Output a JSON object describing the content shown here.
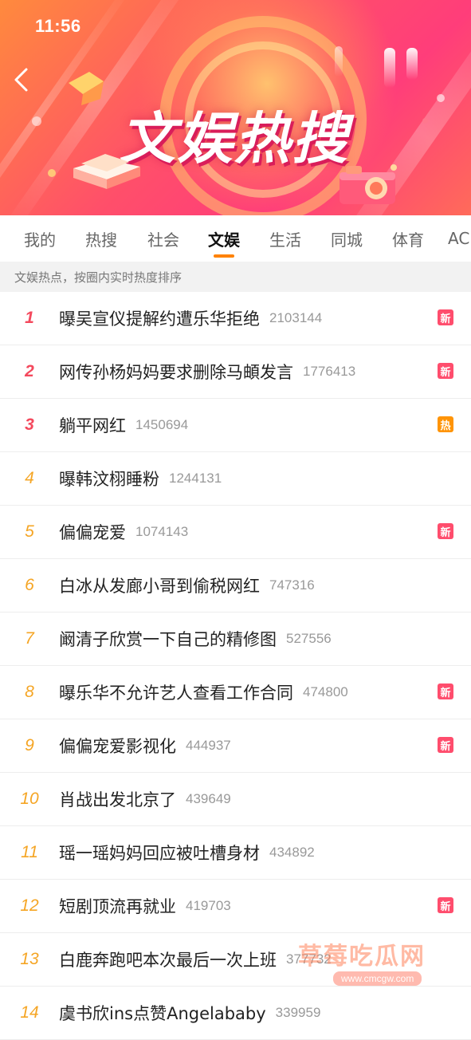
{
  "status_bar": {
    "time": "11:56"
  },
  "banner": {
    "title": "文娱热搜"
  },
  "tabs": [
    {
      "label": "我的",
      "active": false
    },
    {
      "label": "热搜",
      "active": false
    },
    {
      "label": "社会",
      "active": false
    },
    {
      "label": "文娱",
      "active": true
    },
    {
      "label": "生活",
      "active": false
    },
    {
      "label": "同城",
      "active": false
    },
    {
      "label": "体育",
      "active": false
    },
    {
      "label": "AC",
      "active": false
    }
  ],
  "hint": "文娱热点，按圈内实时热度排序",
  "list": [
    {
      "rank": "1",
      "title": "曝吴宣仪提解约遭乐华拒绝",
      "count": "2103144",
      "badge": "新",
      "badge_type": "new"
    },
    {
      "rank": "2",
      "title": "网传孙杨妈妈要求删除马頔发言",
      "count": "1776413",
      "badge": "新",
      "badge_type": "new"
    },
    {
      "rank": "3",
      "title": "躺平网红",
      "count": "1450694",
      "badge": "热",
      "badge_type": "hot"
    },
    {
      "rank": "4",
      "title": "曝韩汶栩睡粉",
      "count": "1244131",
      "badge": "",
      "badge_type": ""
    },
    {
      "rank": "5",
      "title": "偏偏宠爱",
      "count": "1074143",
      "badge": "新",
      "badge_type": "new"
    },
    {
      "rank": "6",
      "title": "白冰从发廊小哥到偷税网红",
      "count": "747316",
      "badge": "",
      "badge_type": ""
    },
    {
      "rank": "7",
      "title": "阚清子欣赏一下自己的精修图",
      "count": "527556",
      "badge": "",
      "badge_type": ""
    },
    {
      "rank": "8",
      "title": "曝乐华不允许艺人查看工作合同",
      "count": "474800",
      "badge": "新",
      "badge_type": "new"
    },
    {
      "rank": "9",
      "title": "偏偏宠爱影视化",
      "count": "444937",
      "badge": "新",
      "badge_type": "new"
    },
    {
      "rank": "10",
      "title": "肖战出发北京了",
      "count": "439649",
      "badge": "",
      "badge_type": ""
    },
    {
      "rank": "11",
      "title": "瑶一瑶妈妈回应被吐槽身材",
      "count": "434892",
      "badge": "",
      "badge_type": ""
    },
    {
      "rank": "12",
      "title": "短剧顶流再就业",
      "count": "419703",
      "badge": "新",
      "badge_type": "new"
    },
    {
      "rank": "13",
      "title": "白鹿奔跑吧本次最后一次上班",
      "count": "377732",
      "badge": "",
      "badge_type": ""
    },
    {
      "rank": "14",
      "title": "虞书欣ins点赞Angelababy",
      "count": "339959",
      "badge": "",
      "badge_type": ""
    }
  ],
  "watermark": {
    "text": "草莓吃瓜网",
    "url": "www.cmcgw.com"
  },
  "colors": {
    "accent": "#ff8200",
    "rank_top": "#f4495d",
    "rank_normal": "#f5a524",
    "badge_new": "#ff4d6d",
    "badge_hot": "#ff9406"
  },
  "icons": {
    "back": "chevron-left-icon",
    "banner_book": "book-icon",
    "banner_camera": "camera-icon"
  }
}
